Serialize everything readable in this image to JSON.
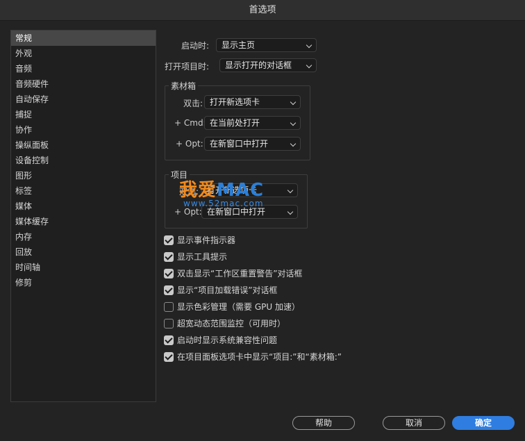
{
  "window": {
    "title": "首选项"
  },
  "sidebar": {
    "items": [
      {
        "label": "常规",
        "active": true
      },
      {
        "label": "外观"
      },
      {
        "label": "音频"
      },
      {
        "label": "音频硬件"
      },
      {
        "label": "自动保存"
      },
      {
        "label": "捕捉"
      },
      {
        "label": "协作"
      },
      {
        "label": "操纵面板"
      },
      {
        "label": "设备控制"
      },
      {
        "label": "图形"
      },
      {
        "label": "标签"
      },
      {
        "label": "媒体"
      },
      {
        "label": "媒体缓存"
      },
      {
        "label": "内存"
      },
      {
        "label": "回放"
      },
      {
        "label": "时间轴"
      },
      {
        "label": "修剪"
      }
    ]
  },
  "general": {
    "startup_label": "启动时:",
    "startup_value": "显示主页",
    "open_project_label": "打开项目时:",
    "open_project_value": "显示打开的对话框"
  },
  "bins": {
    "title": "素材箱",
    "double_click_label": "双击:",
    "double_click_value": "打开新选项卡",
    "cmd_label": "+ Cmd:",
    "cmd_value": "在当前处打开",
    "opt_label": "+ Opt:",
    "opt_value": "在新窗口中打开"
  },
  "project": {
    "title": "项目",
    "double_click_label": "双击:",
    "double_click_value": "打开新选项卡",
    "opt_label": "+ Opt:",
    "opt_value": "在新窗口中打开"
  },
  "checkboxes": [
    {
      "label": "显示事件指示器",
      "checked": true
    },
    {
      "label": "显示工具提示",
      "checked": true
    },
    {
      "label": "双击显示“工作区重置警告”对话框",
      "checked": true
    },
    {
      "label": "显示“项目加载错误”对话框",
      "checked": true
    },
    {
      "label": "显示色彩管理（需要 GPU 加速）",
      "checked": false
    },
    {
      "label": "超宽动态范围监控（可用时）",
      "checked": false
    },
    {
      "label": "启动时显示系统兼容性问题",
      "checked": true
    },
    {
      "label": "在项目面板选项卡中显示“项目:”和“素材箱:”",
      "checked": true
    }
  ],
  "buttons": {
    "help": "帮助",
    "cancel": "取消",
    "ok": "确定"
  },
  "watermark": {
    "brand": "我爱",
    "brand_mac": "MAC",
    "url": "www.52mac.com"
  },
  "colors": {
    "accent": "#2f7de0",
    "sidebar_active": "#474747",
    "watermark_orange": "#f08a1c",
    "watermark_blue": "#2b7fd8"
  }
}
